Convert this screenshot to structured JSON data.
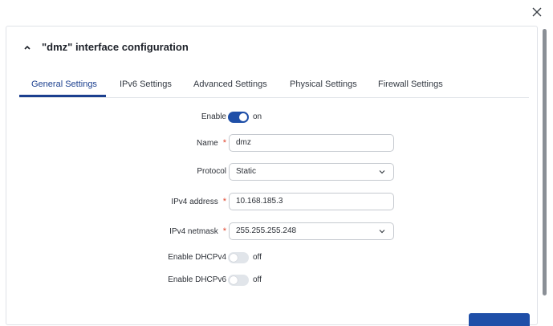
{
  "modal": {
    "title": "\"dmz\" interface configuration",
    "close_icon": "close-icon",
    "collapse_icon": "chevron-up-icon"
  },
  "tabs": [
    {
      "label": "General Settings",
      "active": true
    },
    {
      "label": "IPv6 Settings",
      "active": false
    },
    {
      "label": "Advanced Settings",
      "active": false
    },
    {
      "label": "Physical Settings",
      "active": false
    },
    {
      "label": "Firewall Settings",
      "active": false
    }
  ],
  "form": {
    "enable": {
      "label": "Enable",
      "state": "on"
    },
    "name": {
      "label": "Name",
      "required": "*",
      "value": "dmz"
    },
    "protocol": {
      "label": "Protocol",
      "value": "Static"
    },
    "ipv4_address": {
      "label": "IPv4 address",
      "required": "*",
      "value": "10.168.185.3"
    },
    "ipv4_netmask": {
      "label": "IPv4 netmask",
      "required": "*",
      "value": "255.255.255.248"
    },
    "dhcpv4": {
      "label": "Enable DHCPv4",
      "state": "off"
    },
    "dhcpv6": {
      "label": "Enable DHCPv6",
      "state": "off"
    }
  },
  "colors": {
    "accent": "#1f4fa8",
    "required": "#e0452e",
    "toggle_off": "#e1e5ea"
  }
}
